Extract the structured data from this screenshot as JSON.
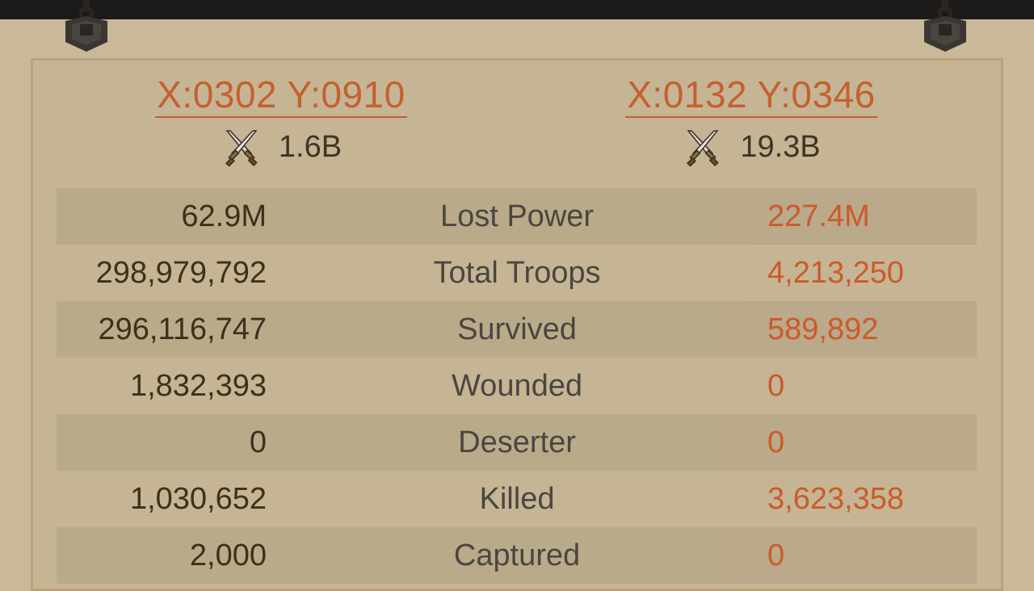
{
  "attacker": {
    "coords": "X:0302 Y:0910",
    "power": "1.6B"
  },
  "defender": {
    "coords": "X:0132 Y:0346",
    "power": "19.3B"
  },
  "icons": {
    "power": "crossed-swords-icon",
    "hook": "hanging-hook-icon"
  },
  "colors": {
    "accent": "#c5602f",
    "defender_value": "#cc5a2a",
    "attacker_value": "#3e2f1d",
    "label": "#4a4640",
    "parchment": "#c9b99a"
  },
  "rows": [
    {
      "label": "Lost Power",
      "left": "62.9M",
      "right": "227.4M"
    },
    {
      "label": "Total Troops",
      "left": "298,979,792",
      "right": "4,213,250"
    },
    {
      "label": "Survived",
      "left": "296,116,747",
      "right": "589,892"
    },
    {
      "label": "Wounded",
      "left": "1,832,393",
      "right": "0"
    },
    {
      "label": "Deserter",
      "left": "0",
      "right": "0"
    },
    {
      "label": "Killed",
      "left": "1,030,652",
      "right": "3,623,358"
    },
    {
      "label": "Captured",
      "left": "2,000",
      "right": "0"
    }
  ]
}
